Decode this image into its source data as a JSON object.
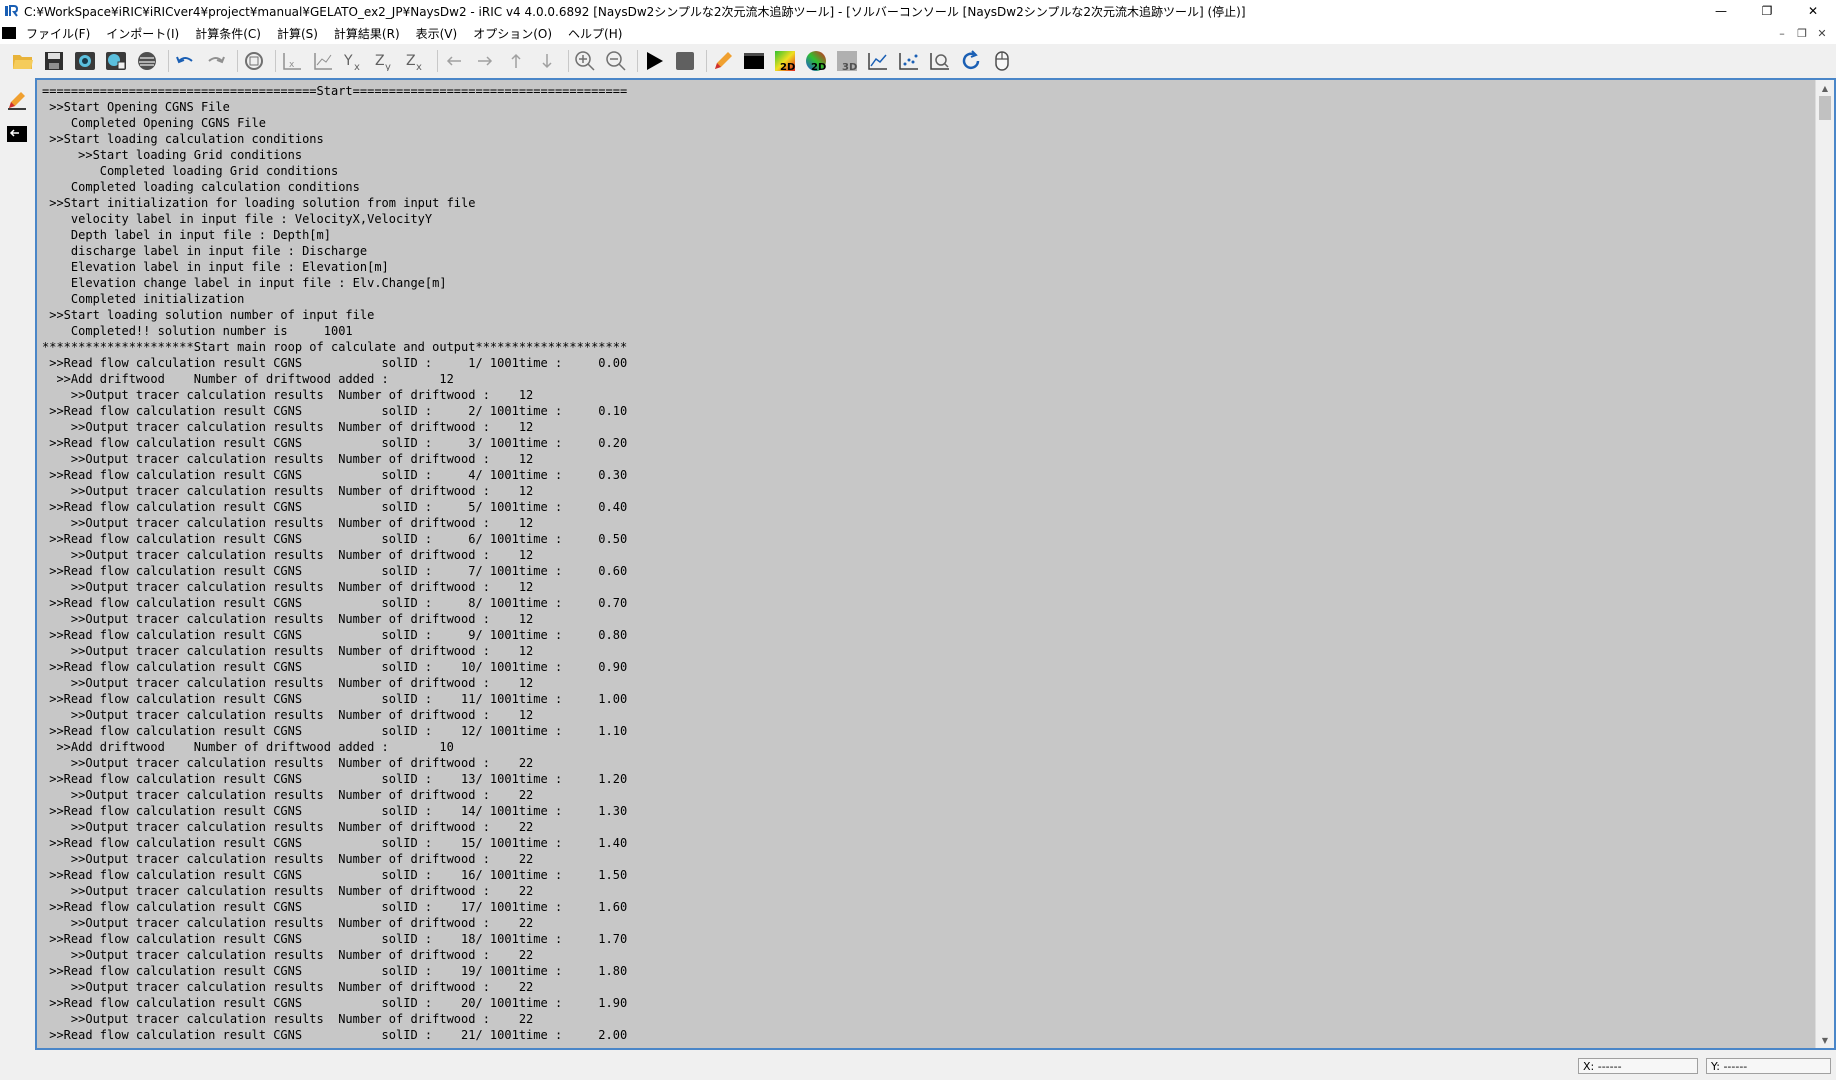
{
  "titlebar": {
    "title": "C:¥WorkSpace¥iRIC¥iRICver4¥project¥manual¥GELATO_ex2_JP¥NaysDw2 - iRIC v4 4.0.0.6892 [NaysDw2シンプルな2次元流木追跡ツール] - [ソルバーコンソール [NaysDw2シンプルな2次元流木追跡ツール] (停止)]",
    "minimize": "—",
    "restore": "❐",
    "close": "✕"
  },
  "menu": {
    "items": [
      "ファイル(F)",
      "インポート(I)",
      "計算条件(C)",
      "計算(S)",
      "計算結果(R)",
      "表示(V)",
      "オプション(O)",
      "ヘルプ(H)"
    ],
    "mdi_minimize": "–",
    "mdi_restore": "❐",
    "mdi_close": "✕"
  },
  "toolbar": {
    "icons": [
      "open-folder-icon",
      "save-icon",
      "capture-icon",
      "continuous-capture-icon",
      "no-entry-icon",
      "undo-icon",
      "redo-icon",
      "zoom-fit-icon",
      "axis-x-icon",
      "axis-xy-icon",
      "yx-icon",
      "zy-icon",
      "zx-icon",
      "arrow-left-icon",
      "arrow-right-icon",
      "arrow-up-icon",
      "arrow-down-icon",
      "zoom-in-icon",
      "zoom-out-icon",
      "run-icon",
      "stop-icon",
      "edit-pencil-icon",
      "console-icon",
      "new-2d-window-icon",
      "new-2d-birdseye-icon",
      "new-3d-window-icon",
      "graph-icon",
      "scatter-icon",
      "zoom-chart-icon",
      "refresh-icon",
      "mouse-icon"
    ]
  },
  "leftdock": {
    "icons": [
      "pre-processor-icon",
      "solver-console-icon"
    ]
  },
  "console": {
    "lines": [
      "======================================Start======================================",
      " >>Start Opening CGNS File",
      "    Completed Opening CGNS File",
      " >>Start loading calculation conditions",
      "     >>Start loading Grid conditions",
      "        Completed loading Grid conditions",
      "    Completed loading calculation conditions",
      " >>Start initialization for loading solution from input file",
      "    velocity label in input file : VelocityX,VelocityY",
      "    Depth label in input file : Depth[m]",
      "    discharge label in input file : Discharge",
      "    Elevation label in input file : Elevation[m]",
      "    Elevation change label in input file : Elv.Change[m]",
      "    Completed initialization",
      " >>Start loading solution number of input file",
      "    Completed!! solution number is     1001",
      "*********************Start main roop of calculate and output*********************",
      " >>Read flow calculation result CGNS           solID :     1/ 1001time :     0.00",
      "  >>Add driftwood    Number of driftwood added :       12",
      "    >>Output tracer calculation results  Number of driftwood :    12",
      " >>Read flow calculation result CGNS           solID :     2/ 1001time :     0.10",
      "    >>Output tracer calculation results  Number of driftwood :    12",
      " >>Read flow calculation result CGNS           solID :     3/ 1001time :     0.20",
      "    >>Output tracer calculation results  Number of driftwood :    12",
      " >>Read flow calculation result CGNS           solID :     4/ 1001time :     0.30",
      "    >>Output tracer calculation results  Number of driftwood :    12",
      " >>Read flow calculation result CGNS           solID :     5/ 1001time :     0.40",
      "    >>Output tracer calculation results  Number of driftwood :    12",
      " >>Read flow calculation result CGNS           solID :     6/ 1001time :     0.50",
      "    >>Output tracer calculation results  Number of driftwood :    12",
      " >>Read flow calculation result CGNS           solID :     7/ 1001time :     0.60",
      "    >>Output tracer calculation results  Number of driftwood :    12",
      " >>Read flow calculation result CGNS           solID :     8/ 1001time :     0.70",
      "    >>Output tracer calculation results  Number of driftwood :    12",
      " >>Read flow calculation result CGNS           solID :     9/ 1001time :     0.80",
      "    >>Output tracer calculation results  Number of driftwood :    12",
      " >>Read flow calculation result CGNS           solID :    10/ 1001time :     0.90",
      "    >>Output tracer calculation results  Number of driftwood :    12",
      " >>Read flow calculation result CGNS           solID :    11/ 1001time :     1.00",
      "    >>Output tracer calculation results  Number of driftwood :    12",
      " >>Read flow calculation result CGNS           solID :    12/ 1001time :     1.10",
      "  >>Add driftwood    Number of driftwood added :       10",
      "    >>Output tracer calculation results  Number of driftwood :    22",
      " >>Read flow calculation result CGNS           solID :    13/ 1001time :     1.20",
      "    >>Output tracer calculation results  Number of driftwood :    22",
      " >>Read flow calculation result CGNS           solID :    14/ 1001time :     1.30",
      "    >>Output tracer calculation results  Number of driftwood :    22",
      " >>Read flow calculation result CGNS           solID :    15/ 1001time :     1.40",
      "    >>Output tracer calculation results  Number of driftwood :    22",
      " >>Read flow calculation result CGNS           solID :    16/ 1001time :     1.50",
      "    >>Output tracer calculation results  Number of driftwood :    22",
      " >>Read flow calculation result CGNS           solID :    17/ 1001time :     1.60",
      "    >>Output tracer calculation results  Number of driftwood :    22",
      " >>Read flow calculation result CGNS           solID :    18/ 1001time :     1.70",
      "    >>Output tracer calculation results  Number of driftwood :    22",
      " >>Read flow calculation result CGNS           solID :    19/ 1001time :     1.80",
      "    >>Output tracer calculation results  Number of driftwood :    22",
      " >>Read flow calculation result CGNS           solID :    20/ 1001time :     1.90",
      "    >>Output tracer calculation results  Number of driftwood :    22",
      " >>Read flow calculation result CGNS           solID :    21/ 1001time :     2.00"
    ]
  },
  "statusbar": {
    "x_readout": "X: ------",
    "y_readout": "Y: ------"
  }
}
